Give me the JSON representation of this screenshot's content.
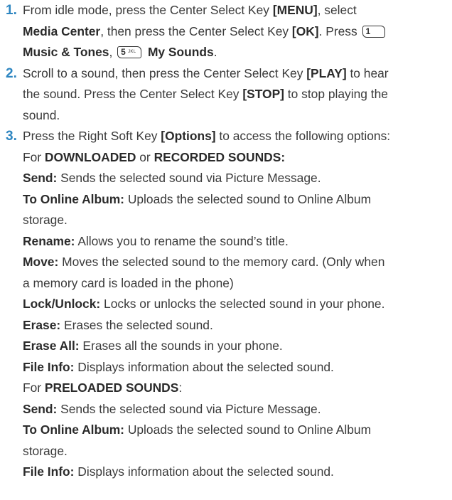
{
  "steps": [
    {
      "num": "1.",
      "parts": [
        {
          "t": "From idle mode, press the Center Select Key "
        },
        {
          "t": "[MENU]",
          "b": true
        },
        {
          "t": ", select"
        },
        {
          "br": true
        },
        {
          "t": "Media Center",
          "b": true
        },
        {
          "t": ", then press the Center Select Key "
        },
        {
          "t": "[OK]",
          "b": true
        },
        {
          "t": ". Press "
        },
        {
          "key": {
            "digit": "1",
            "sub": "",
            "icon": "key-1-voicemail-icon",
            "w": 30
          }
        },
        {
          "br": true
        },
        {
          "t": "Music & Tones",
          "b": true
        },
        {
          "t": ",  "
        },
        {
          "key": {
            "digit": "5",
            "sub": "JKL",
            "icon": "key-5-jkl-icon",
            "w": 32
          }
        },
        {
          "t": " My Sounds",
          "b": true
        },
        {
          "t": "."
        }
      ]
    },
    {
      "num": "2.",
      "parts": [
        {
          "t": "Scroll to a sound, then press the Center Select Key "
        },
        {
          "t": "[PLAY]",
          "b": true
        },
        {
          "t": " to hear"
        },
        {
          "br": true
        },
        {
          "t": "the sound. Press the Center Select Key "
        },
        {
          "t": "[STOP]",
          "b": true
        },
        {
          "t": " to stop playing the"
        },
        {
          "br": true
        },
        {
          "t": "sound."
        }
      ]
    },
    {
      "num": "3.",
      "parts": [
        {
          "t": "Press the Right Soft Key "
        },
        {
          "t": "[Options]",
          "b": true
        },
        {
          "t": " to access the following options:"
        },
        {
          "br": true
        },
        {
          "t": "For "
        },
        {
          "t": "DOWNLOADED",
          "b": true
        },
        {
          "t": " or "
        },
        {
          "t": "RECORDED SOUNDS:",
          "b": true
        },
        {
          "br": true
        },
        {
          "t": "Send:",
          "b": true
        },
        {
          "t": " Sends the selected sound via Picture Message."
        },
        {
          "br": true
        },
        {
          "t": "To Online Album:",
          "b": true
        },
        {
          "t": " Uploads the selected sound to Online Album"
        },
        {
          "br": true
        },
        {
          "t": "storage."
        },
        {
          "br": true
        },
        {
          "t": "Rename:",
          "b": true
        },
        {
          "t": " Allows you to rename the sound’s title."
        },
        {
          "br": true
        },
        {
          "t": "Move:",
          "b": true
        },
        {
          "t": " Moves the selected sound to the memory card. (Only when"
        },
        {
          "br": true
        },
        {
          "t": "a memory card is loaded in the phone)"
        },
        {
          "br": true
        },
        {
          "t": "Lock/Unlock:",
          "b": true
        },
        {
          "t": " Locks or unlocks the selected sound in your phone."
        },
        {
          "br": true
        },
        {
          "t": "Erase:",
          "b": true
        },
        {
          "t": " Erases the selected sound."
        },
        {
          "br": true
        },
        {
          "t": "Erase All:",
          "b": true
        },
        {
          "t": " Erases all the sounds in your phone."
        },
        {
          "br": true
        },
        {
          "t": "File Info:",
          "b": true
        },
        {
          "t": " Displays information about the selected sound."
        },
        {
          "br": true
        },
        {
          "t": "For "
        },
        {
          "t": "PRELOADED SOUNDS",
          "b": true
        },
        {
          "t": ":"
        },
        {
          "br": true
        },
        {
          "t": "Send:",
          "b": true
        },
        {
          "t": " Sends the selected sound via Picture Message."
        },
        {
          "br": true
        },
        {
          "t": "To Online Album:",
          "b": true
        },
        {
          "t": " Uploads the selected sound to Online Album"
        },
        {
          "br": true
        },
        {
          "t": "storage."
        },
        {
          "br": true
        },
        {
          "t": "File Info:",
          "b": true
        },
        {
          "t": " Displays information about the selected sound."
        }
      ]
    }
  ],
  "colors": {
    "number": "#2e86c1",
    "text": "#3a3a3a",
    "bold": "#2b2b2b"
  }
}
